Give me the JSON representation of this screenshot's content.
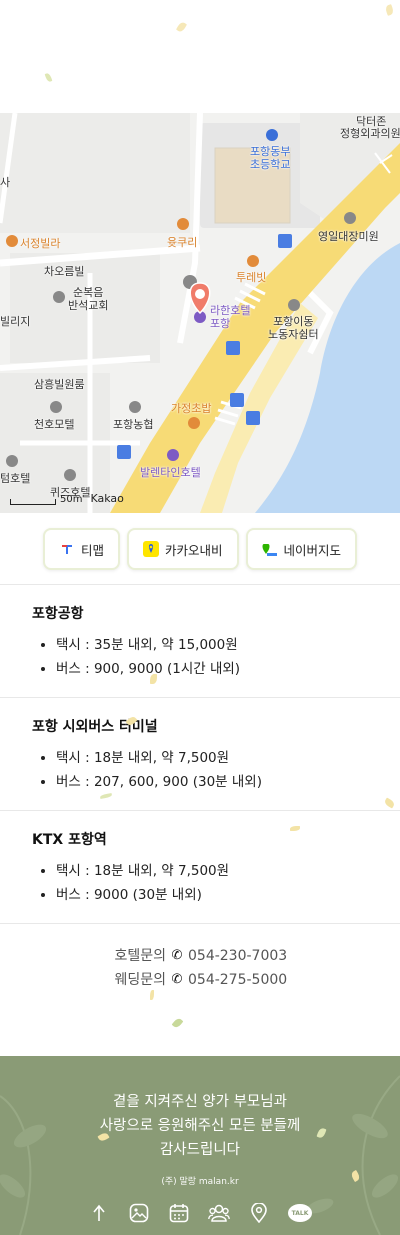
{
  "map": {
    "labels": {
      "doctor_zone": "닥터존",
      "jeonghyeong": "정형외과의원",
      "school": "포항동부\n초등학교",
      "sa": "사",
      "yeongil_clinic": "영일대장미원",
      "seodeok_villa": "서정빌라",
      "yunkuri": "윳쿠리",
      "chaohleum_vill": "차오름빌",
      "trevit": "투레빗",
      "church": "순복음\n반석교회",
      "rahan_hotel": "라한호텔\n포항",
      "pohang_idong": "포항이동\n노동자쉼터",
      "villiji": "빌리지",
      "samheung": "삼흥빌원룸",
      "cheonho_motel": "천호모텔",
      "pohang_nonghyeop": "포항농협",
      "gajeong_chobap": "가정초밥",
      "valentine_hotel": "발렌타인호텔",
      "tem_hotel": "텀호텔",
      "kwijeu_hotel": "퀴즈호텔"
    },
    "scale_text": "50m",
    "provider": "Kakao"
  },
  "nav_buttons": [
    {
      "label": "티맵",
      "icon": "tmap-icon"
    },
    {
      "label": "카카오내비",
      "icon": "kakaonavi-icon"
    },
    {
      "label": "네이버지도",
      "icon": "navermap-icon"
    }
  ],
  "sections": [
    {
      "title": "포항공항",
      "items": [
        "택시 : 35분 내외, 약 15,000원",
        "버스 : 900, 9000 (1시간 내외)"
      ]
    },
    {
      "title": "포항 시외버스 터미널",
      "items": [
        "택시 : 18분 내외, 약 7,500원",
        "버스 : 207, 600, 900 (30분 내외)"
      ]
    },
    {
      "title": "KTX 포항역",
      "items": [
        "택시 : 18분 내외, 약 7,500원",
        "버스 : 9000 (30분 내외)"
      ]
    }
  ],
  "contacts": [
    {
      "label": "호텔문의",
      "number": "054-230-7003"
    },
    {
      "label": "웨딩문의",
      "number": "054-275-5000"
    }
  ],
  "footer": {
    "line1": "곁을 지켜주신 양가 부모님과",
    "line2": "사랑으로 응원해주신 모든 분들께",
    "line3": "감사드립니다",
    "brand": "(주) 말랑 malan.kr",
    "icons": [
      "up-arrow-icon",
      "gallery-icon",
      "calendar-icon",
      "people-icon",
      "location-icon",
      "talk-icon"
    ],
    "talk_text": "TALK"
  },
  "colors": {
    "footer_bg": "#8a9b76",
    "road_yellow": "#f6dc7a",
    "sea_blue": "#bfd9f2",
    "hotel_marker": "#f07c6a",
    "petal": "#f3e3a6"
  }
}
